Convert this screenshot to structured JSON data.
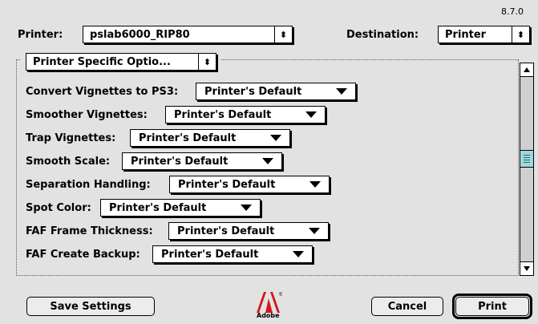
{
  "version": "8.7.0",
  "header": {
    "printer_label": "Printer:",
    "printer_value": "pslab6000_RIP80",
    "destination_label": "Destination:",
    "destination_value": "Printer"
  },
  "panel": {
    "selector_value": "Printer Specific Optio..."
  },
  "options": [
    {
      "label": "Convert Vignettes to PS3:",
      "value": "Printer's Default"
    },
    {
      "label": "Smoother Vignettes:",
      "value": "Printer's Default"
    },
    {
      "label": "Trap Vignettes:",
      "value": "Printer's Default"
    },
    {
      "label": "Smooth Scale:",
      "value": "Printer's Default"
    },
    {
      "label": "Separation Handling:",
      "value": "Printer's Default"
    },
    {
      "label": "Spot Color:",
      "value": "Printer's Default"
    },
    {
      "label": "FAF Frame Thickness:",
      "value": "Printer's Default"
    },
    {
      "label": "FAF Create Backup:",
      "value": "Printer's Default"
    }
  ],
  "footer": {
    "save_label": "Save Settings",
    "cancel_label": "Cancel",
    "print_label": "Print",
    "logo_text": "Adobe"
  },
  "icons": {
    "popup_arrows": "up-down-arrows-icon",
    "menu_arrow": "triangle-down-icon",
    "scroll_up": "scroll-up-arrow-icon",
    "scroll_down": "scroll-down-arrow-icon",
    "logo": "adobe-logo"
  }
}
